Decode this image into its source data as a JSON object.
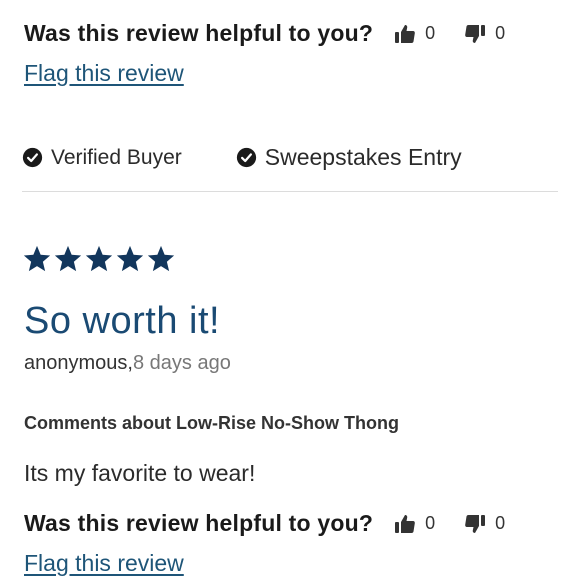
{
  "top_helpful": {
    "question": "Was this review helpful to you?",
    "up_count": "0",
    "down_count": "0",
    "flag": "Flag this review"
  },
  "badges": {
    "verified": "Verified Buyer",
    "sweepstakes": "Sweepstakes Entry"
  },
  "review": {
    "rating": 5,
    "title": "So worth it!",
    "author": "anonymous,",
    "date": "8 days ago",
    "about": "Comments about Low-Rise No-Show Thong",
    "body": "Its my favorite to wear!"
  },
  "bottom_helpful": {
    "question": "Was this review helpful to you?",
    "up_count": "0",
    "down_count": "0",
    "flag": "Flag this review"
  },
  "colors": {
    "star": "#12365c",
    "title": "#1a4a73",
    "link": "#1e5578"
  },
  "icons": [
    "thumbs-up-icon",
    "thumbs-down-icon",
    "check-circle-icon",
    "star-icon"
  ]
}
